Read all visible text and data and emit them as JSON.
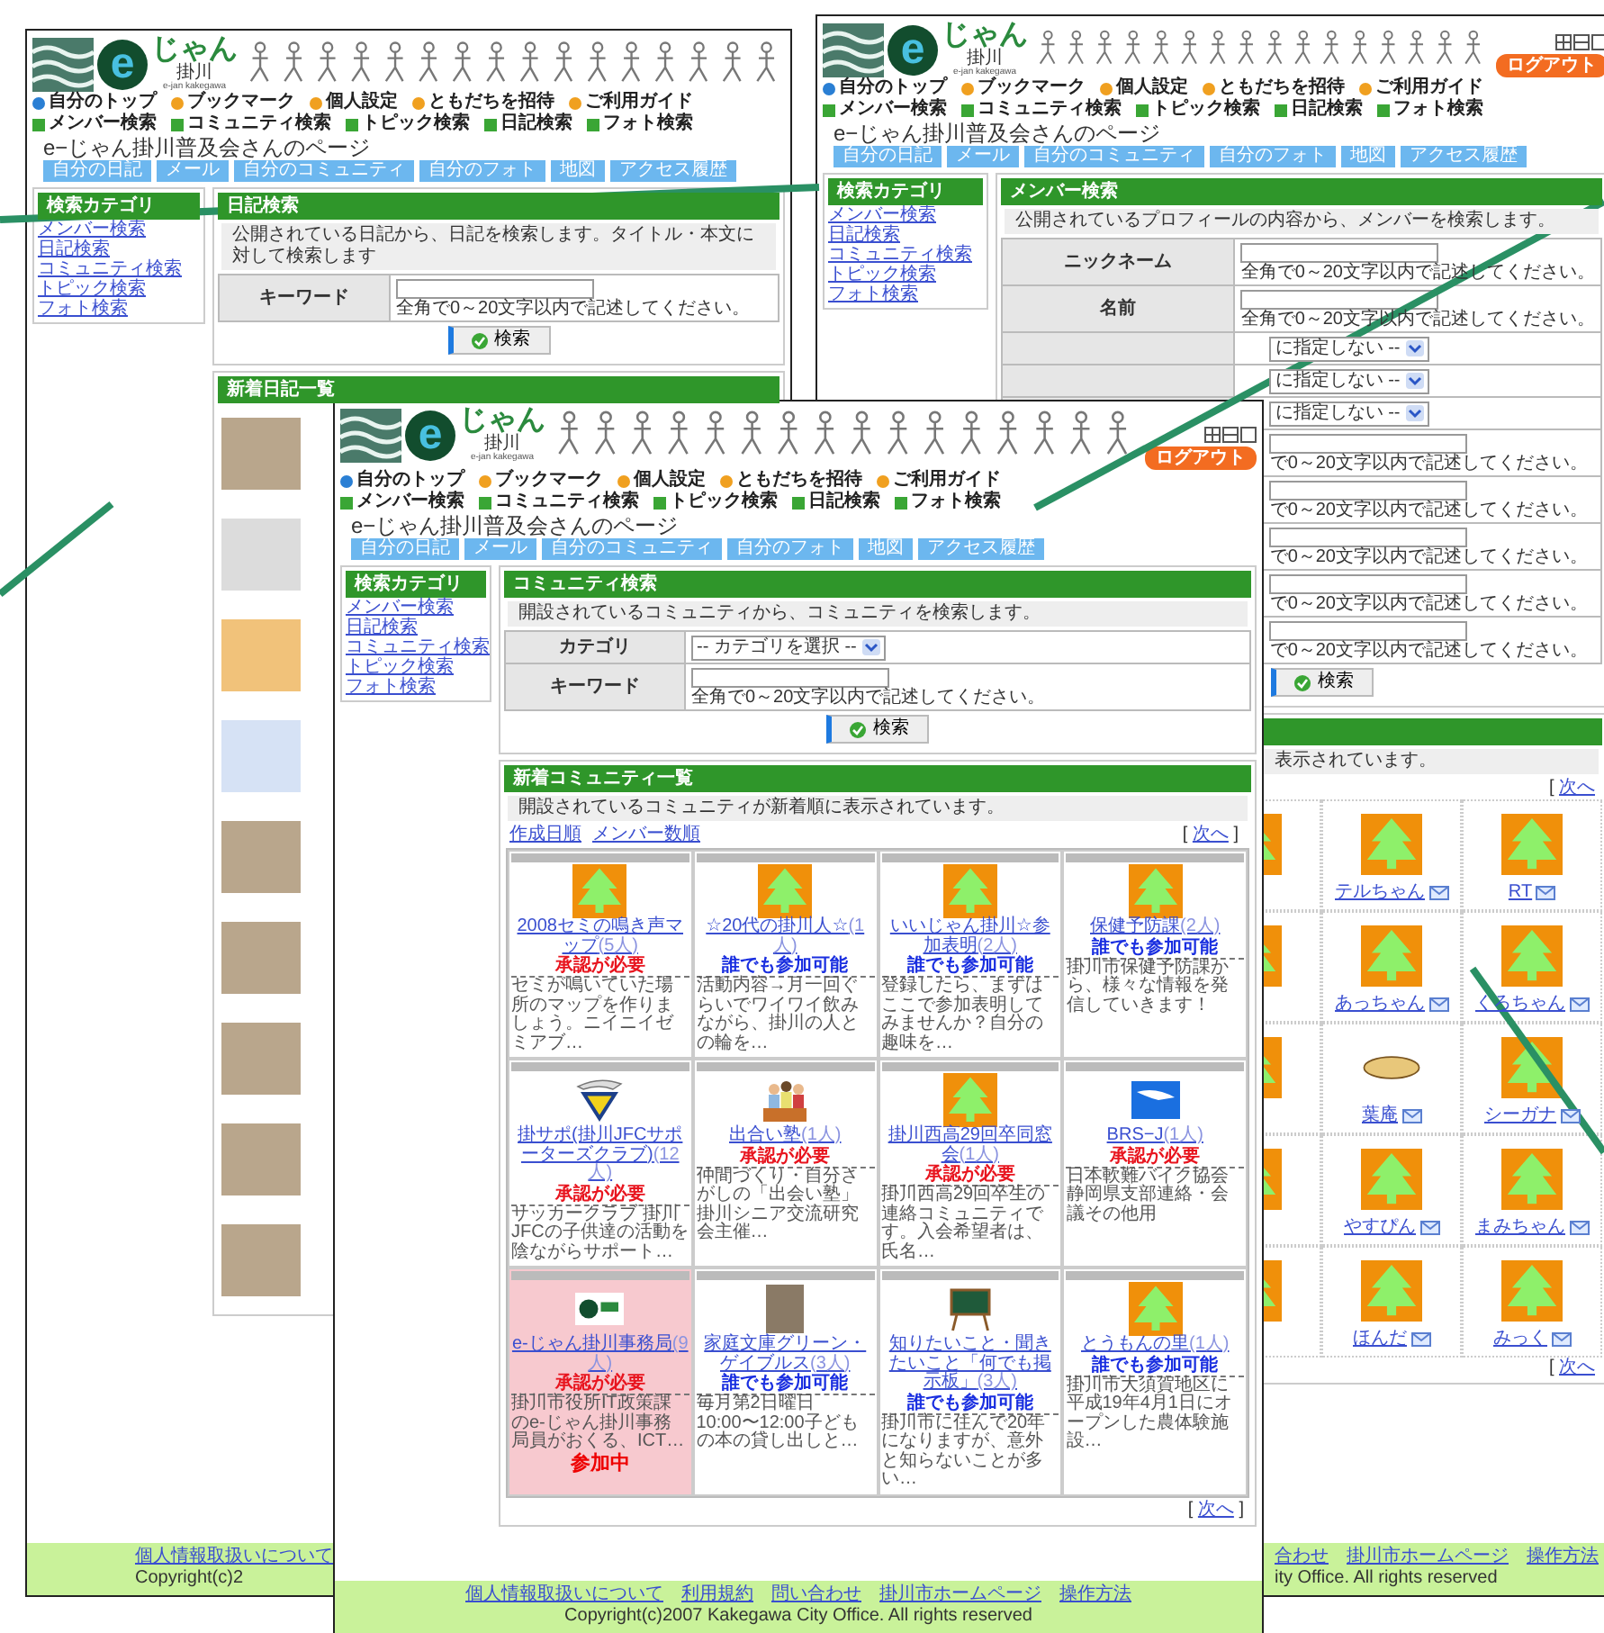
{
  "windows": [
    {
      "kind": "diary",
      "logo": {
        "mark": "e",
        "name": "じゃん",
        "city": "掛川",
        "romaji": "e-jan kakegawa"
      },
      "menu_top": [
        {
          "label": "自分のトップ",
          "color": "#2a7fd4"
        },
        {
          "label": "ブックマーク",
          "color": "#f0a020"
        },
        {
          "label": "個人設定",
          "color": "#f0a020"
        },
        {
          "label": "ともだちを招待",
          "color": "#f0a020"
        },
        {
          "label": "ご利用ガイド",
          "color": "#f0a020"
        }
      ],
      "menu_search": [
        "メンバー検索",
        "コミュニティ検索",
        "トピック検索",
        "日記検索",
        "フォト検索"
      ],
      "page_title": "e−じゃん掛川普及会さんのページ",
      "tabs": [
        "自分の日記",
        "メール",
        "自分のコミュニティ",
        "自分のフォト",
        "地図",
        "アクセス履歴"
      ],
      "sidebar": {
        "title": "検索カテゴリ",
        "links": [
          "メンバー検索",
          "日記検索",
          "コミュニティ検索",
          "トピック検索",
          "フォト検索"
        ]
      },
      "search": {
        "title": "日記検索",
        "description": "公開されている日記から、日記を検索します。タイトル・本文に対して検索します",
        "rows": [
          {
            "label": "キーワード",
            "kind": "text",
            "hint": "全角で0～20文字以内で記述してください。"
          }
        ],
        "button": "検索"
      },
      "list": {
        "title": "新着日記一覧",
        "entries": [
          {
            "kind": "photo"
          },
          {
            "kind": "drawing"
          },
          {
            "kind": "character"
          },
          {
            "kind": "logo"
          },
          {
            "kind": "photo"
          },
          {
            "kind": "photo"
          },
          {
            "kind": "photo"
          },
          {
            "kind": "photo"
          },
          {
            "kind": "photo"
          }
        ]
      },
      "footer": {
        "links": [
          "個人情報取扱いについて"
        ],
        "copyright": "Copyright(c)2"
      }
    },
    {
      "kind": "member",
      "logo": {
        "mark": "e",
        "name": "じゃん",
        "city": "掛川",
        "romaji": "e-jan kakegawa"
      },
      "logout": "ログアウト",
      "menu_top": [
        {
          "label": "自分のトップ",
          "color": "#2a7fd4"
        },
        {
          "label": "ブックマーク",
          "color": "#f0a020"
        },
        {
          "label": "個人設定",
          "color": "#f0a020"
        },
        {
          "label": "ともだちを招待",
          "color": "#f0a020"
        },
        {
          "label": "ご利用ガイド",
          "color": "#f0a020"
        }
      ],
      "menu_search": [
        "メンバー検索",
        "コミュニティ検索",
        "トピック検索",
        "日記検索",
        "フォト検索"
      ],
      "page_title": "e−じゃん掛川普及会さんのページ",
      "tabs": [
        "自分の日記",
        "メール",
        "自分のコミュニティ",
        "自分のフォト",
        "地図",
        "アクセス履歴"
      ],
      "sidebar": {
        "title": "検索カテゴリ",
        "links": [
          "メンバー検索",
          "日記検索",
          "コミュニティ検索",
          "トピック検索",
          "フォト検索"
        ]
      },
      "search": {
        "title": "メンバー検索",
        "description": "公開されているプロフィールの内容から、メンバーを検索します。",
        "rows": [
          {
            "label": "ニックネーム",
            "kind": "text",
            "hint": "全角で0～20文字以内で記述してください。"
          },
          {
            "label": "名前",
            "kind": "text",
            "hint": "全角で0～20文字以内で記述してください。"
          },
          {
            "kind": "select",
            "value": "に指定しない --"
          },
          {
            "kind": "select",
            "value": "に指定しない --"
          },
          {
            "kind": "select",
            "value": "に指定しない --"
          },
          {
            "kind": "text",
            "hint": "で0～20文字以内で記述してください。"
          },
          {
            "kind": "text",
            "hint": "で0～20文字以内で記述してください。"
          },
          {
            "kind": "text",
            "hint": "で0～20文字以内で記述してください。"
          },
          {
            "kind": "text",
            "hint": "で0～20文字以内で記述してください。"
          },
          {
            "kind": "text",
            "hint": "で0～20文字以内で記述してください。"
          }
        ],
        "button": "検索"
      },
      "list": {
        "description": "表示されています。",
        "pager": {
          "open": "[",
          "link": "次へ"
        },
        "members": [
          {
            "kind": "tree"
          },
          {
            "kind": "tree",
            "name": "テルちゃん"
          },
          {
            "kind": "tree",
            "name": "RT"
          },
          {
            "kind": "tree"
          },
          {
            "kind": "tree",
            "name": "あっちゃん"
          },
          {
            "kind": "tree",
            "name": "くろちゃん"
          },
          {
            "kind": "tree"
          },
          {
            "kind": "sign",
            "name": "葉庵"
          },
          {
            "kind": "tree",
            "name": "シーガナ"
          },
          {
            "kind": "tree"
          },
          {
            "kind": "tree",
            "name": "やすぴん"
          },
          {
            "kind": "tree",
            "name": "まみちゃん"
          },
          {
            "kind": "tree"
          },
          {
            "kind": "tree",
            "name": "ほんだ"
          },
          {
            "kind": "tree",
            "name": "みっく"
          }
        ],
        "pager_bottom": {
          "open": "[",
          "link": "次へ"
        }
      },
      "footer": {
        "links": [
          "合わせ",
          "掛川市ホームページ",
          "操作方法"
        ],
        "copyright": "ity Office. All rights reserved"
      }
    },
    {
      "kind": "community",
      "logo": {
        "mark": "e",
        "name": "じゃん",
        "city": "掛川",
        "romaji": "e-jan kakegawa"
      },
      "logout": "ログアウト",
      "menu_top": [
        {
          "label": "自分のトップ",
          "color": "#2a7fd4"
        },
        {
          "label": "ブックマーク",
          "color": "#f0a020"
        },
        {
          "label": "個人設定",
          "color": "#f0a020"
        },
        {
          "label": "ともだちを招待",
          "color": "#f0a020"
        },
        {
          "label": "ご利用ガイド",
          "color": "#f0a020"
        }
      ],
      "menu_search": [
        "メンバー検索",
        "コミュニティ検索",
        "トピック検索",
        "日記検索",
        "フォト検索"
      ],
      "page_title": "e−じゃん掛川普及会さんのページ",
      "tabs": [
        "自分の日記",
        "メール",
        "自分のコミュニティ",
        "自分のフォト",
        "地図",
        "アクセス履歴"
      ],
      "sidebar": {
        "title": "検索カテゴリ",
        "links": [
          "メンバー検索",
          "日記検索",
          "コミュニティ検索",
          "トピック検索",
          "フォト検索"
        ]
      },
      "search": {
        "title": "コミュニティ検索",
        "description": "開設されているコミュニティから、コミュニティを検索します。",
        "rows": [
          {
            "label": "カテゴリ",
            "kind": "select",
            "value": "-- カテゴリを選択 --"
          },
          {
            "label": "キーワード",
            "kind": "text",
            "hint": "全角で0～20文字以内で記述してください。"
          }
        ],
        "button": "検索"
      },
      "list": {
        "title": "新着コミュニティ一覧",
        "description": "開設されているコミュニティが新着順に表示されています。",
        "sort": [
          "作成日順",
          "メンバー数順"
        ],
        "pager": {
          "open": "[",
          "link": "次へ",
          "close": "]"
        },
        "cards": [
          {
            "kind": "tree",
            "title": "2008セミの鳴き声マップ",
            "count": "(5人)",
            "status": {
              "text": "承認が必要",
              "color": "#e8141e"
            },
            "description": "セミが鳴いていた場所のマップを作りましょう。ニイニイゼミアブ…",
            "joined": false
          },
          {
            "kind": "tree",
            "title": "☆20代の掛川人☆",
            "count": "(1人)",
            "status": {
              "text": "誰でも参加可能",
              "color": "#1a2fe0"
            },
            "description": "活動内容→月一回ぐらいでワイワイ飲みながら、掛川の人との輪を…",
            "joined": false
          },
          {
            "kind": "tree",
            "title": "いいじゃん掛川☆参加表明",
            "count": "(2人)",
            "status": {
              "text": "誰でも参加可能",
              "color": "#1a2fe0"
            },
            "description": "登録したら、まずはここで参加表明してみませんか？自分の趣味を…",
            "joined": false
          },
          {
            "kind": "tree",
            "title": "保健予防課",
            "count": "(2人)",
            "status": {
              "text": "誰でも参加可能",
              "color": "#1a2fe0"
            },
            "description": "掛川市保健予防課から、様々な情報を発信していきます！",
            "joined": false
          },
          {
            "kind": "emblem",
            "title": "掛サポ(掛川JFCサポーターズクラブ)",
            "count": "(12人)",
            "status": {
              "text": "承認が必要",
              "color": "#e8141e"
            },
            "description": "サッカークラブ 掛川JFCの子供達の活動を陰ながらサポート…",
            "joined": false
          },
          {
            "kind": "people",
            "title": "出合い塾",
            "count": "(1人)",
            "status": {
              "text": "承認が必要",
              "color": "#e8141e"
            },
            "description": "仲間づくり・自分さがしの「出会い塾」掛川シニア交流研究会主催…",
            "joined": false
          },
          {
            "kind": "tree",
            "title": "掛川西高29回卒同窓会",
            "count": "(1人)",
            "status": {
              "text": "承認が必要",
              "color": "#e8141e"
            },
            "description": "掛川西高29回卒生の連絡コミュニティです。入会希望者は、氏名…",
            "joined": false
          },
          {
            "kind": "bird",
            "title": "BRS−J",
            "count": "(1人)",
            "status": {
              "text": "承認が必要",
              "color": "#e8141e"
            },
            "description": "日本軟難バイク協会静岡県支部連絡・会議その他用",
            "joined": false
          },
          {
            "kind": "logo",
            "title": "e-じゃん掛川事務局",
            "count": "(9人)",
            "status": {
              "text": "承認が必要",
              "color": "#e8141e"
            },
            "description": "掛川市役所IT政策課のe-じゃん掛川事務局員がおくる、ICT…",
            "joined": true,
            "joined_label": "参加中"
          },
          {
            "kind": "photo",
            "title": "家庭文庫グリーン・ゲイブルス",
            "count": "(3人)",
            "status": {
              "text": "誰でも参加可能",
              "color": "#1a2fe0"
            },
            "description": "毎月第2日曜日 10:00〜12:00子どもの本の貸し出しと…",
            "joined": false
          },
          {
            "kind": "board",
            "title": "知りたいこと・聞きたいこと「何でも掲示板」",
            "count": "(3人)",
            "status": {
              "text": "誰でも参加可能",
              "color": "#1a2fe0"
            },
            "description": "掛川市に住んで20年になりますが、意外と知らないことが多い…",
            "joined": false
          },
          {
            "kind": "tree",
            "title": "とうもんの里",
            "count": "(1人)",
            "status": {
              "text": "誰でも参加可能",
              "color": "#1a2fe0"
            },
            "description": "掛川市大須賀地区に平成19年4月1日にオープンした農体験施設…",
            "joined": false
          }
        ],
        "pager_bottom": {
          "open": "[",
          "link": "次へ",
          "close": "]"
        }
      },
      "footer": {
        "links": [
          "個人情報取扱いについて",
          "利用規約",
          "問い合わせ",
          "掛川市ホームページ",
          "操作方法"
        ],
        "copyright": "Copyright(c)2007 Kakegawa City Office. All rights reserved"
      }
    }
  ]
}
